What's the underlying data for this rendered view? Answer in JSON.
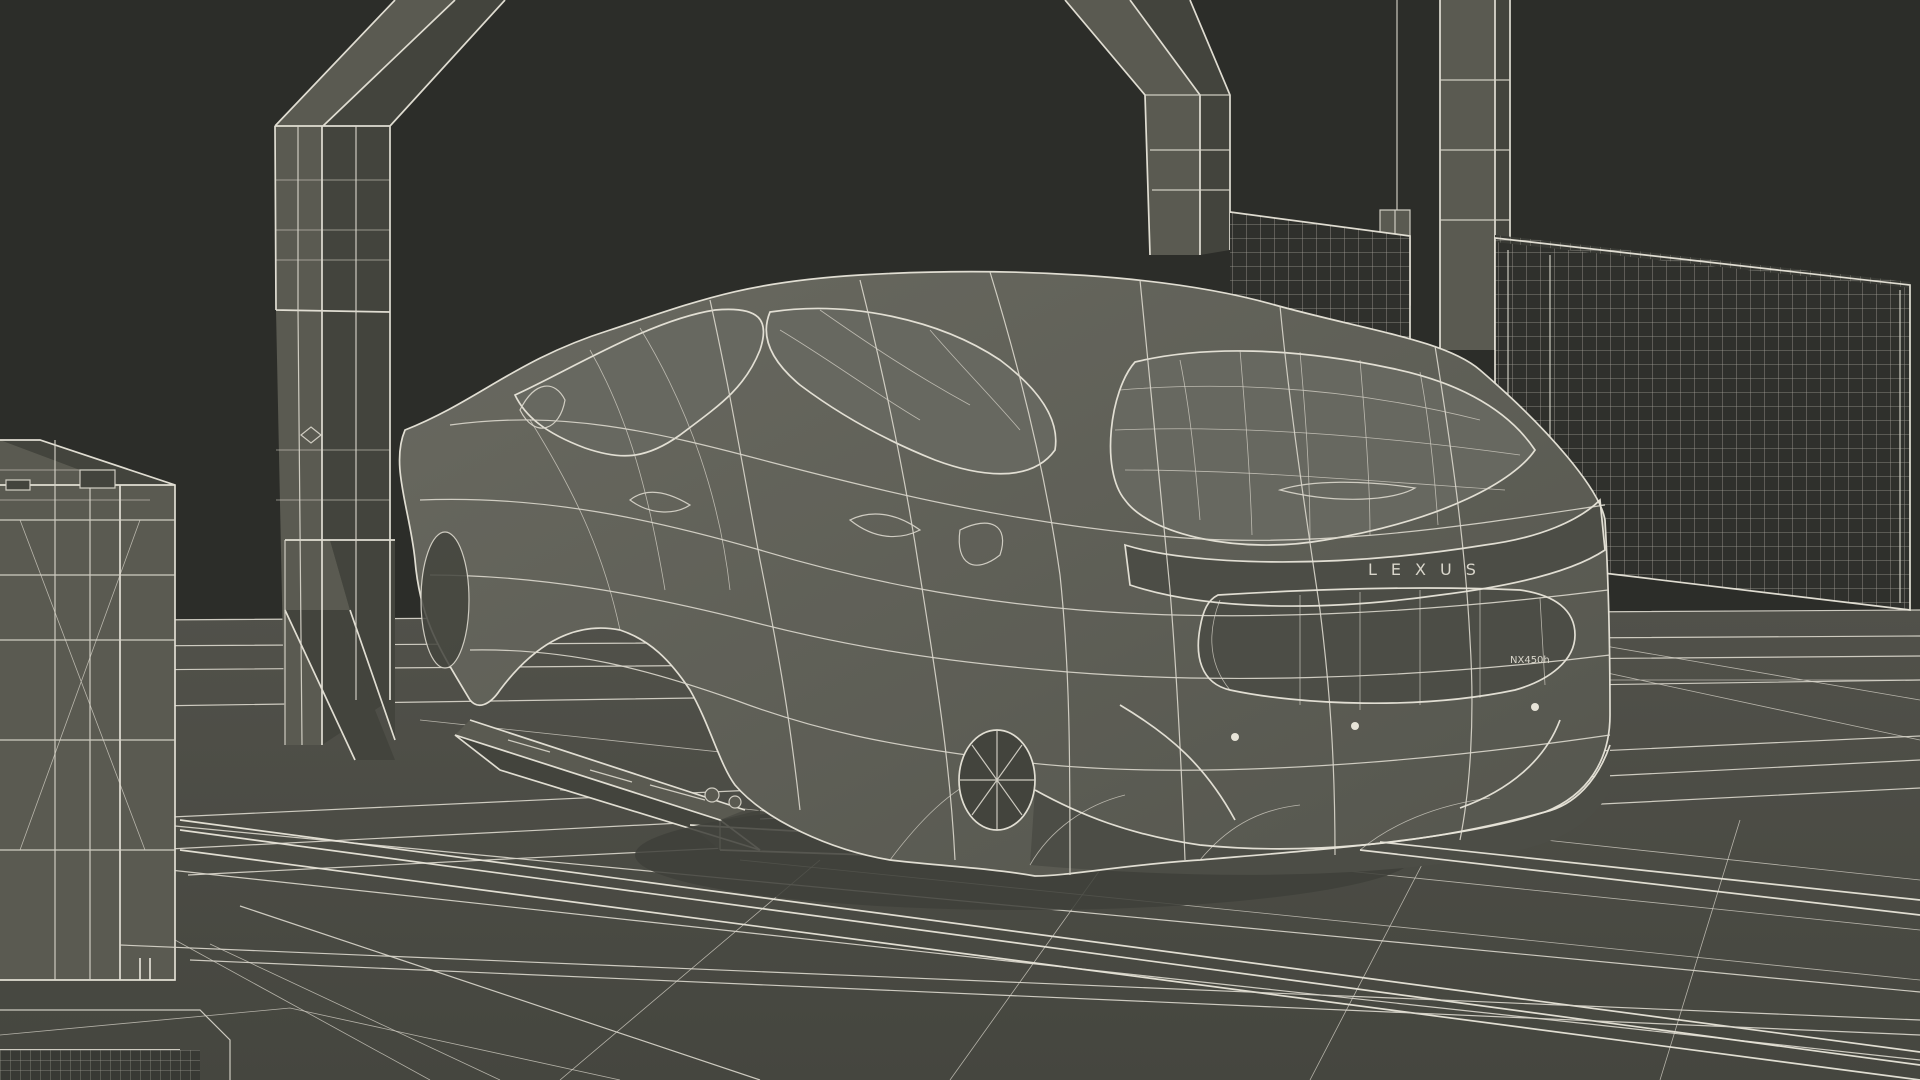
{
  "scene": {
    "background_color": "#262626",
    "floor_color": "#4c4c45",
    "wireframe_color": "#d9d6cb",
    "metal_color": "#5a5a51",
    "car_color": "#62625a"
  },
  "vehicle": {
    "brand_text": "LEXUS",
    "model_text": "NX450h"
  }
}
